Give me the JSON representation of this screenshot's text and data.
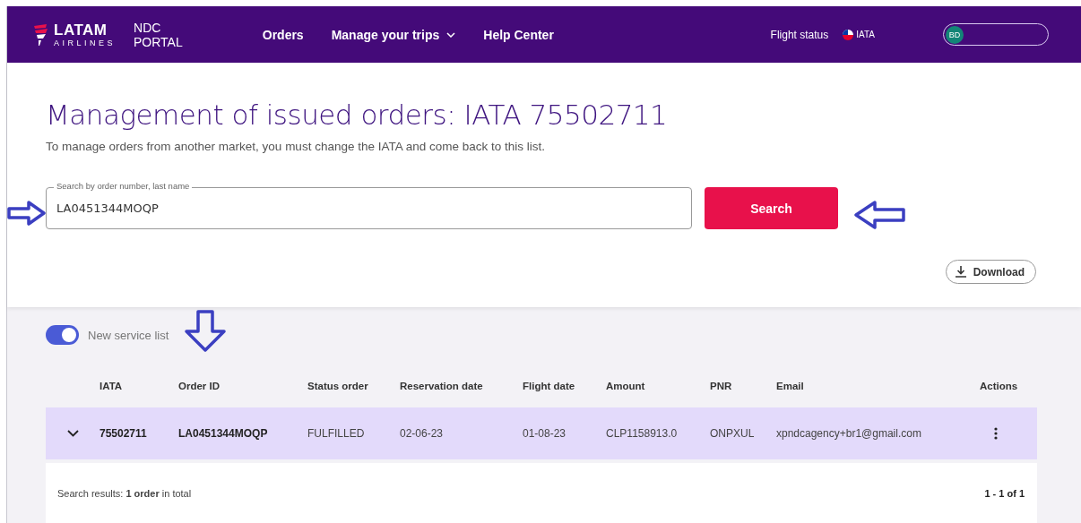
{
  "header": {
    "logo_name": "LATAM",
    "logo_sub": "AIRLINES",
    "portal": [
      "NDC",
      "PORTAL"
    ],
    "nav": [
      {
        "label": "Orders",
        "dropdown": false
      },
      {
        "label": "Manage your trips",
        "dropdown": true
      },
      {
        "label": "Help Center",
        "dropdown": false
      }
    ],
    "flight_status": "Flight status",
    "market": "IATA",
    "user_initials": "BD"
  },
  "title": "Management of issued orders: IATA 75502711",
  "subtitle": "To manage orders from another market, you must change the IATA and come back to this list.",
  "search": {
    "label": "Search by order number, last name",
    "value": "LA0451344MOQP",
    "button": "Search"
  },
  "download": "Download",
  "toggle": {
    "label": "New service list",
    "on": true
  },
  "table": {
    "columns": [
      "IATA",
      "Order ID",
      "Status order",
      "Reservation date",
      "Flight date",
      "Amount",
      "PNR",
      "Email",
      "Actions"
    ],
    "rows": [
      {
        "cells": [
          "75502711",
          "LA0451344MOQP",
          "FULFILLED",
          "02-06-23",
          "01-08-23",
          "CLP1158913.0",
          "ONPXUL",
          "xpndcagency+br1@gmail.com"
        ]
      }
    ]
  },
  "footer": {
    "results": "Search results: **1 order** in total",
    "range": "1 - 1 of 1"
  }
}
